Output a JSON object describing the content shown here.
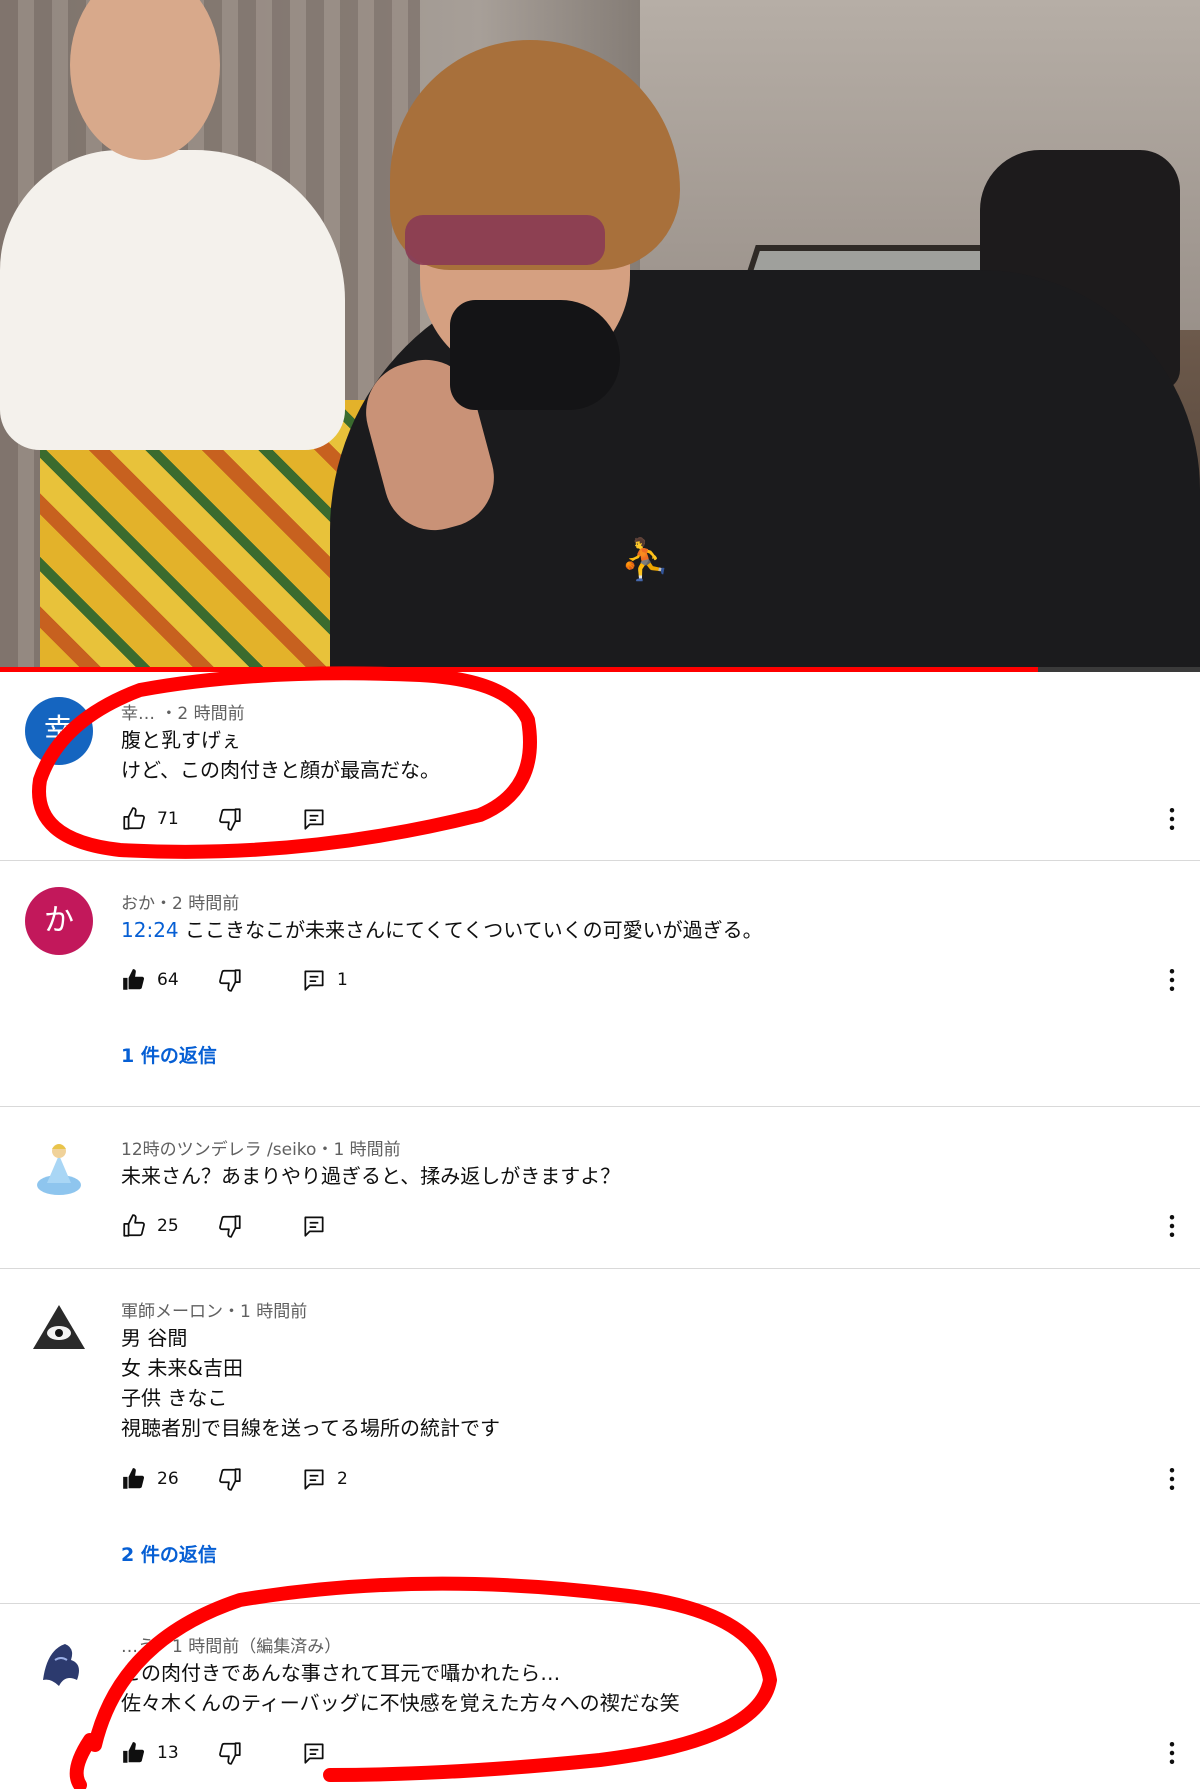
{
  "video": {
    "progress_fraction": 0.865
  },
  "comments": [
    {
      "meta": "幸… ・2 時間前",
      "avatar": {
        "text": "幸",
        "color": "#1565c0"
      },
      "lines": [
        "腹と乳すげぇ",
        "けど、この肉付きと顔が最高だな。"
      ],
      "likes": "71",
      "liked": false,
      "reply_count": ""
    },
    {
      "meta": "おか・2 時間前",
      "avatar": {
        "text": "か",
        "color": "#c2185b"
      },
      "timestamp": "12:24",
      "lines": [
        "ここきなこが未来さんにてくてくついていくの可愛いが過ぎる。"
      ],
      "likes": "64",
      "liked": true,
      "reply_count": "1",
      "replies_link": "1 件の返信"
    },
    {
      "meta": "12時のツンデレラ /seiko・1 時間前",
      "avatar": {
        "icon": "princess-avatar-icon"
      },
      "lines": [
        "未来さん？あまりやり過ぎると、揉み返しがきますよ？"
      ],
      "likes": "25",
      "liked": false,
      "reply_count": ""
    },
    {
      "meta": "軍師メーロン・1 時間前",
      "avatar": {
        "icon": "eye-pyramid-avatar-icon"
      },
      "lines": [
        "男 谷間",
        "女 未来&吉田",
        "子供 きなこ",
        "視聴者別で目線を送ってる場所の統計です"
      ],
      "likes": "26",
      "liked": true,
      "reply_count": "2",
      "replies_link": "2 件の返信"
    },
    {
      "meta": "…う・1 時間前（編集済み）",
      "avatar": {
        "icon": "dragon-avatar-icon"
      },
      "lines": [
        "この肉付きであんな事されて耳元で囁かれたら…",
        "佐々木くんのティーバッグに不快感を覚えた方々への禊だな笑"
      ],
      "likes": "13",
      "liked": true,
      "reply_count": ""
    }
  ],
  "annotation": {
    "color": "#ff0000"
  }
}
